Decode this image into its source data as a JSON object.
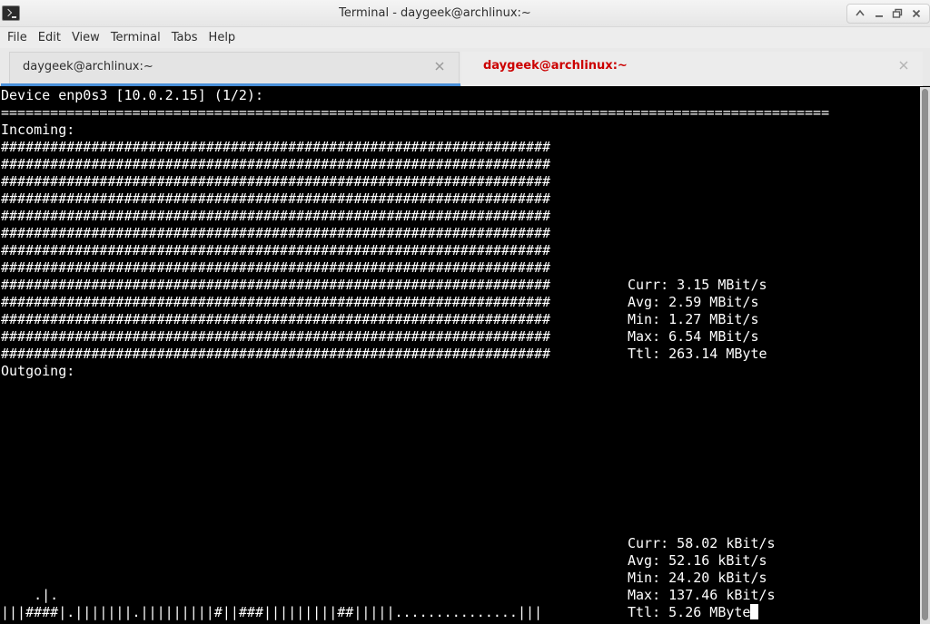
{
  "window": {
    "title": "Terminal - daygeek@archlinux:~"
  },
  "menu": [
    "File",
    "Edit",
    "View",
    "Terminal",
    "Tabs",
    "Help"
  ],
  "tabs": [
    {
      "label": "daygeek@archlinux:~",
      "active": true
    },
    {
      "label": "daygeek@archlinux:~",
      "active": false,
      "color": "#cc0000"
    }
  ],
  "terminal": {
    "device_line": "Device enp0s3 [10.0.2.15] (1/2):",
    "separator": "=====================================================================================================",
    "incoming_label": "Incoming:",
    "outgoing_label": "Outgoing:",
    "incoming_graph_row": "###################################################################",
    "incoming_stats": {
      "curr": "Curr: 3.15 MBit/s",
      "avg": "Avg: 2.59 MBit/s",
      "min": "Min: 1.27 MBit/s",
      "max": "Max: 6.54 MBit/s",
      "ttl": "Ttl: 263.14 MByte"
    },
    "outgoing_graph_top": "    .|.",
    "outgoing_graph_bottom": "|||####|.|||||||.|||||||||#||###|||||||||##|||||...............|||",
    "outgoing_stats": {
      "curr": "Curr: 58.02 kBit/s",
      "avg": "Avg: 52.16 kBit/s",
      "min": "Min: 24.20 kBit/s",
      "max": "Max: 137.46 kBit/s",
      "ttl": "Ttl: 5.26 MByte"
    }
  },
  "colors": {
    "accent": "#4a90d9",
    "inactive_tab_text": "#cc0000",
    "terminal_bg": "#000000",
    "terminal_fg": "#ffffff"
  },
  "icons": {
    "app": "terminal-icon",
    "maximize": "arrow-up-icon",
    "minimize": "minimize-icon",
    "restore": "restore-icon",
    "close": "close-icon"
  }
}
